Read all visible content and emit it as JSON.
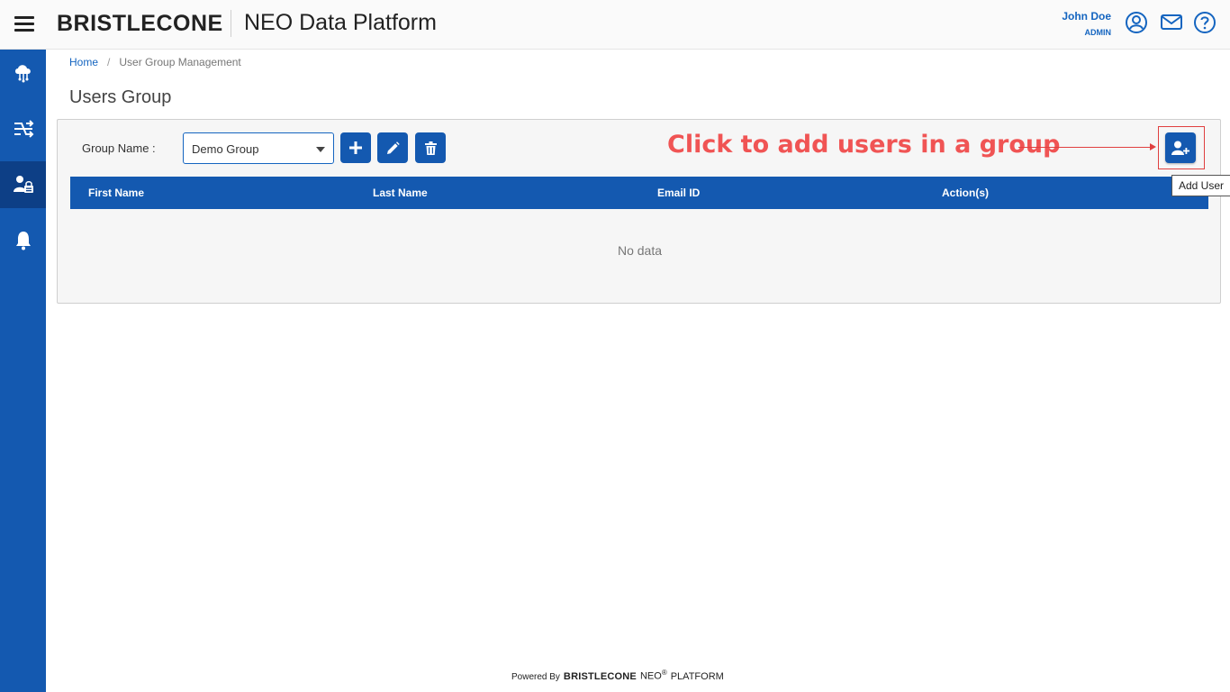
{
  "header": {
    "logo": "BRISTLECONE",
    "app_title": "NEO Data Platform",
    "user_name": "John Doe",
    "user_role": "ADMIN",
    "icons": [
      "account-circle-icon",
      "mail-icon",
      "help-icon"
    ]
  },
  "sidebar": {
    "items": [
      {
        "icon": "cloud-network-icon",
        "active": false
      },
      {
        "icon": "shuffle-settings-icon",
        "active": false
      },
      {
        "icon": "user-group-management-icon",
        "active": true
      },
      {
        "icon": "notification-bell-icon",
        "active": false
      }
    ]
  },
  "breadcrumb": {
    "home": "Home",
    "separator": "/",
    "current": "User Group Management"
  },
  "page": {
    "title": "Users Group"
  },
  "group_selector": {
    "label": "Group Name :",
    "selected": "Demo Group",
    "buttons": [
      "add-icon",
      "edit-pencil-icon",
      "delete-trash-icon"
    ]
  },
  "annotation": {
    "text": "Click to add users in a group"
  },
  "add_user": {
    "tooltip": "Add User",
    "icon": "user-plus-icon"
  },
  "table": {
    "columns": [
      "First Name",
      "Last Name",
      "Email ID",
      "Action(s)"
    ],
    "empty_text": "No data"
  },
  "footer": {
    "powered_by": "Powered By",
    "logo": "BRISTLECONE",
    "neo": "NEO",
    "reg": "®",
    "platform": "PLATFORM"
  },
  "colors": {
    "primary": "#1459b0",
    "sidebar_active": "#0d3f86",
    "link": "#1565c0",
    "annotation": "#f05454"
  }
}
